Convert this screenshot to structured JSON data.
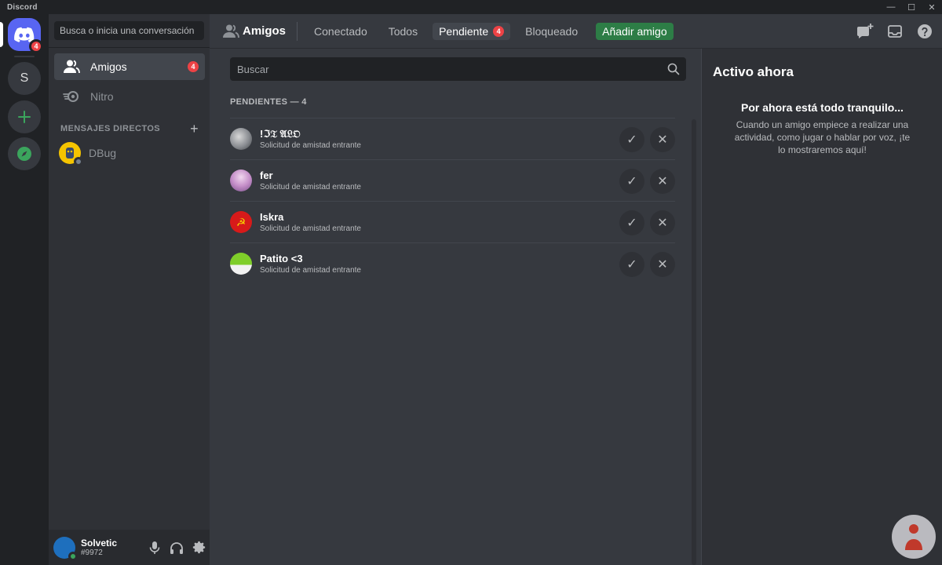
{
  "window": {
    "title": "Discord",
    "minimize_glyph": "—",
    "maximize_glyph": "☐",
    "close_glyph": "✕"
  },
  "server_rail": {
    "home_badge": "4",
    "server_initial": "S",
    "add_glyph": "+",
    "icons": [
      "discord-logo-icon",
      "plus-icon",
      "compass-icon"
    ]
  },
  "sidebar": {
    "search_label": "Busca o inicia una conversación",
    "nav": [
      {
        "label": "Amigos",
        "badge": "4",
        "icon": "friends-icon"
      },
      {
        "label": "Nitro",
        "icon": "nitro-icon"
      }
    ],
    "dm_header": "MENSAJES DIRECTOS",
    "dm_add": "+",
    "dms": [
      {
        "name": "DBug",
        "status": "offline"
      }
    ]
  },
  "user_panel": {
    "name": "Solvetic",
    "tag": "#9972",
    "status": "online",
    "icons": [
      "microphone-icon",
      "headphones-icon",
      "gear-icon"
    ]
  },
  "topbar": {
    "title": "Amigos",
    "tabs": [
      {
        "label": "Conectado"
      },
      {
        "label": "Todos"
      },
      {
        "label": "Pendiente",
        "badge": "4",
        "active": true
      },
      {
        "label": "Bloqueado"
      }
    ],
    "add_friend": "Añadir amigo",
    "icons": [
      "new-group-dm-icon",
      "inbox-icon",
      "help-icon"
    ]
  },
  "friends": {
    "search_placeholder": "Buscar",
    "section_title": "PENDIENTES — 4",
    "pending": [
      {
        "name": "!ℑ𝔗 𝔄𝔏𝔒",
        "subtitle": "Solicitud de amistad entrante",
        "avatar_color": "#8a8d92"
      },
      {
        "name": "fer",
        "subtitle": "Solicitud de amistad entrante",
        "avatar_color": "#c58fc9"
      },
      {
        "name": "Iskra",
        "subtitle": "Solicitud de amistad entrante",
        "avatar_color": "#d71a1a"
      },
      {
        "name": "Patito <3",
        "subtitle": "Solicitud de amistad entrante",
        "avatar_color": "#7fce2a"
      }
    ],
    "accept_glyph": "✓",
    "reject_glyph": "✕"
  },
  "active_now": {
    "title": "Activo ahora",
    "empty_title": "Por ahora está todo tranquilo...",
    "empty_desc": "Cuando un amigo empiece a realizar una actividad, como jugar o hablar por voz, ¡te lo mostraremos aquí!"
  },
  "colors": {
    "brand": "#5865f2",
    "badge": "#ed4245",
    "add_friend_bg": "#2d7d46",
    "online": "#3ba55d"
  }
}
